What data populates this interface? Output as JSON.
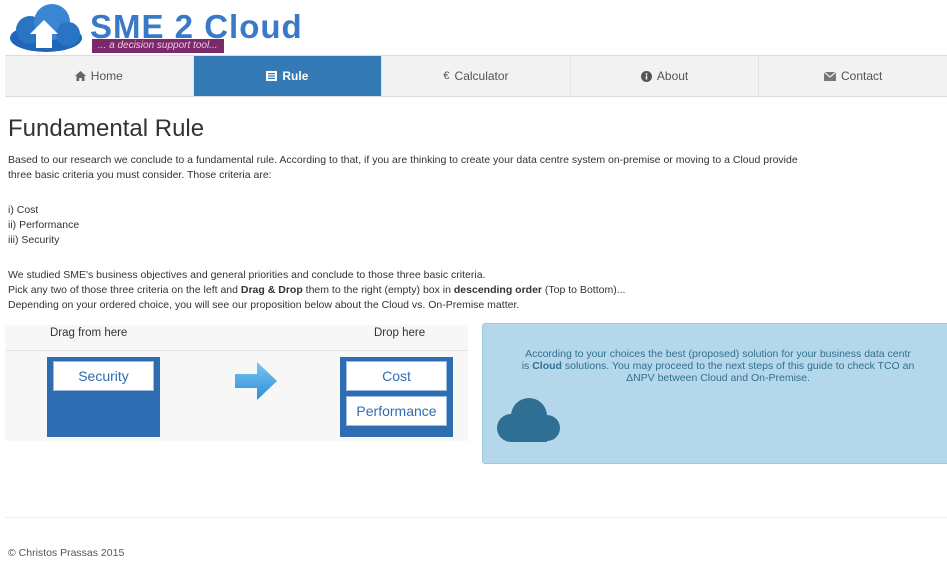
{
  "logo": {
    "title": "SME 2 Cloud",
    "subtitle": "... a decision support tool..."
  },
  "nav": {
    "items": [
      {
        "label": "Home",
        "icon": "home-icon"
      },
      {
        "label": "Rule",
        "icon": "list-icon",
        "active": true
      },
      {
        "label": "Calculator",
        "icon": "euro-icon"
      },
      {
        "label": "About",
        "icon": "info-icon"
      },
      {
        "label": "Contact",
        "icon": "envelope-icon"
      }
    ]
  },
  "page": {
    "title": "Fundamental Rule",
    "intro_line1": "Based to our research we conclude to a fundamental rule. According to that, if you are thinking to create your data centre system on-premise or moving to a Cloud provide",
    "intro_line2": "three basic criteria you must consider. Those criteria are:",
    "criteria": [
      "i) Cost",
      "ii) Performance",
      "iii) Security"
    ],
    "instr_line1": "We studied SME's business objectives and general priorities and conclude to those three basic criteria.",
    "instr_line2_a": "Pick any two of those three criteria on the left and ",
    "instr_line2_b": "Drag & Drop",
    "instr_line2_c": " them to the right (empty) box in ",
    "instr_line2_d": "descending order",
    "instr_line2_e": " (Top to Bottom)...",
    "instr_line3": "Depending on your ordered choice, you will see our proposition below about the Cloud vs. On-Premise matter."
  },
  "dnd": {
    "drag_label": "Drag from here",
    "drop_label": "Drop here",
    "source_items": [
      "Security"
    ],
    "target_items": [
      "Cost",
      "Performance"
    ]
  },
  "result": {
    "line1": "According to your choices the best (proposed) solution for your business data centr",
    "line2_a": "is ",
    "line2_b": "Cloud",
    "line2_c": " solutions. You may proceed to the next steps of this guide to check TCO an",
    "line3": "ΔNPV between Cloud and On-Premise."
  },
  "footer": {
    "text": "© Christos Prassas 2015"
  },
  "colors": {
    "accent": "#337ab7",
    "box": "#2f6db3",
    "result_bg": "#b5d7ec",
    "result_text": "#31708f"
  }
}
